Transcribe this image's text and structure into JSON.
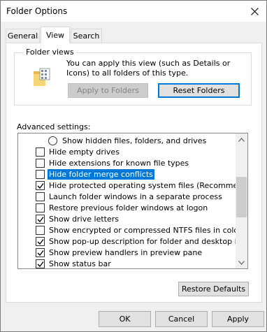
{
  "window": {
    "title": "Folder Options"
  },
  "tabs": [
    {
      "label": "General",
      "active": false
    },
    {
      "label": "View",
      "active": true
    },
    {
      "label": "Search",
      "active": false
    }
  ],
  "folder_views": {
    "legend": "Folder views",
    "description": "You can apply this view (such as Details or Icons) to all folders of this type.",
    "apply_button": "Apply to Folders",
    "reset_button": "Reset Folders"
  },
  "advanced": {
    "label": "Advanced settings:",
    "items": [
      {
        "type": "radio",
        "label": "Show hidden files, folders, and drives",
        "checked": false
      },
      {
        "type": "check",
        "label": "Hide empty drives",
        "checked": false
      },
      {
        "type": "check",
        "label": "Hide extensions for known file types",
        "checked": false
      },
      {
        "type": "check",
        "label": "Hide folder merge conflicts",
        "checked": false,
        "selected": true
      },
      {
        "type": "check",
        "label": "Hide protected operating system files (Recommended)",
        "checked": true
      },
      {
        "type": "check",
        "label": "Launch folder windows in a separate process",
        "checked": false
      },
      {
        "type": "check",
        "label": "Restore previous folder windows at logon",
        "checked": false
      },
      {
        "type": "check",
        "label": "Show drive letters",
        "checked": true
      },
      {
        "type": "check",
        "label": "Show encrypted or compressed NTFS files in color",
        "checked": false
      },
      {
        "type": "check",
        "label": "Show pop-up description for folder and desktop items",
        "checked": true
      },
      {
        "type": "check",
        "label": "Show preview handlers in preview pane",
        "checked": true
      },
      {
        "type": "check",
        "label": "Show status bar",
        "checked": true
      }
    ],
    "restore_defaults": "Restore Defaults"
  },
  "footer": {
    "ok": "OK",
    "cancel": "Cancel",
    "apply": "Apply"
  },
  "colors": {
    "accent": "#0078d7",
    "selection": "#0078d7"
  },
  "icons": {
    "close": "close-icon",
    "folder": "folder-icon",
    "scroll_up": "chevron-up-icon",
    "scroll_down": "chevron-down-icon",
    "checkmark": "checkmark-icon"
  }
}
